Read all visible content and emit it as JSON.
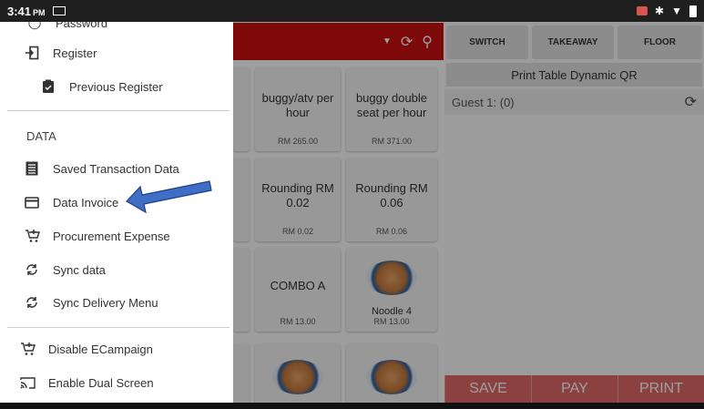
{
  "status_bar": {
    "time": "3:41",
    "ampm": "PM"
  },
  "drawer": {
    "cut_off_label": "Password",
    "items_top": [
      {
        "label": "Register",
        "icon": "login-icon"
      },
      {
        "label": "Previous Register",
        "icon": "clipboard-icon"
      }
    ],
    "section_header": "DATA",
    "data_items": [
      {
        "label": "Saved Transaction Data",
        "icon": "list-icon"
      },
      {
        "label": "Data Invoice",
        "icon": "card-icon"
      },
      {
        "label": "Procurement Expense",
        "icon": "cart-icon"
      },
      {
        "label": "Sync data",
        "icon": "sync-icon"
      },
      {
        "label": "Sync Delivery Menu",
        "icon": "sync-icon"
      }
    ],
    "bottom_items": [
      {
        "label": "Disable ECampaign",
        "icon": "cart-icon"
      },
      {
        "label": "Enable Dual Screen",
        "icon": "cast-icon"
      }
    ]
  },
  "menu_tiles": [
    {
      "name": "buggy/atv per hour",
      "price": "RM 265.00"
    },
    {
      "name": "buggy double seat per hour",
      "price": "RM 371.00"
    },
    {
      "name": "Rounding RM 0.02",
      "price": "RM 0.02"
    },
    {
      "name": "Rounding RM 0.06",
      "price": "RM 0.06"
    },
    {
      "name": "COMBO A",
      "price": "RM 13.00"
    },
    {
      "name": "Noodle 4",
      "price": "RM 13.00"
    }
  ],
  "order_panel": {
    "tabs": [
      "SWITCH",
      "TAKEAWAY",
      "FLOOR"
    ],
    "qr_button": "Print Table Dynamic QR",
    "guest_label": "Guest 1: (0)",
    "actions": [
      "SAVE",
      "PAY",
      "PRINT"
    ]
  },
  "colors": {
    "accent": "#cc1010",
    "arrow": "#3f6fc4"
  }
}
